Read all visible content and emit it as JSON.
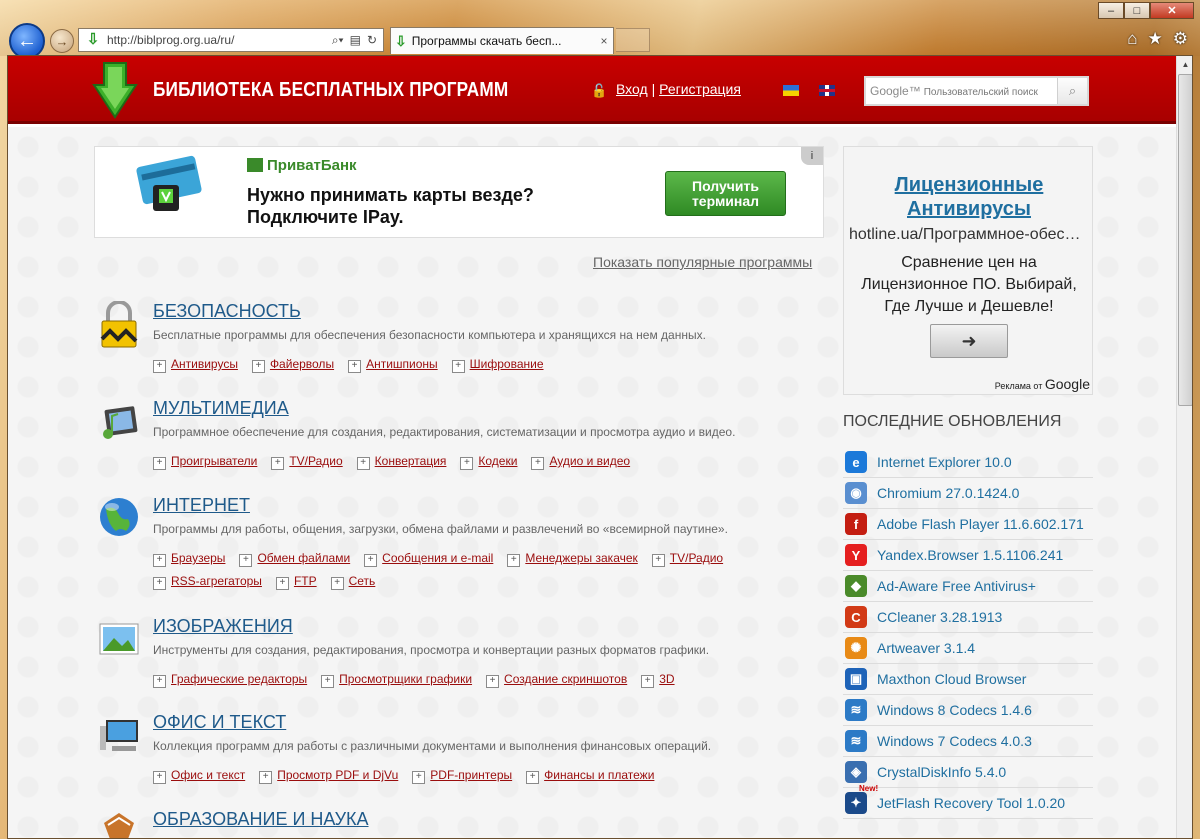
{
  "browser": {
    "url": "http://biblprog.org.ua/ru/",
    "tab_title": "Программы скачать бесп...",
    "tab_close": "×",
    "window_controls": {
      "minimize": "–",
      "maximize": "□",
      "close": "✕"
    }
  },
  "header": {
    "logo_text": "БИБЛИОТЕКА БЕСПЛАТНЫХ ПРОГРАММ",
    "login": "Вход",
    "separator": "|",
    "register": "Регистрация",
    "search_brand": "Google™",
    "search_placeholder": "Пользовательский поиск"
  },
  "banner": {
    "brand": "ПриватБанк",
    "line1": "Нужно принимать карты везде?",
    "line2": "Подключите IPay.",
    "button_line1": "Получить",
    "button_line2": "терминал",
    "info": "i"
  },
  "popular_link": "Показать популярные программы",
  "categories": [
    {
      "title": "БЕЗОПАСНОСТЬ",
      "desc": "Бесплатные программы для обеспечения безопасности компьютера и хранящихся на нем данных.",
      "links": [
        "Антивирусы",
        "Файерволы",
        "Антишпионы",
        "Шифрование"
      ]
    },
    {
      "title": "МУЛЬТИМЕДИА",
      "desc": "Программное обеспечение для создания, редактирования, систематизации и просмотра аудио и видео.",
      "links": [
        "Проигрыватели",
        "TV/Радио",
        "Конвертация",
        "Кодеки",
        "Аудио и видео"
      ]
    },
    {
      "title": "ИНТЕРНЕТ",
      "desc": "Программы для работы, общения, загрузки, обмена файлами и развлечений во «всемирной паутине».",
      "links": [
        "Браузеры",
        "Обмен файлами",
        "Сообщения и e-mail",
        "Менеджеры закачек",
        "TV/Радио",
        "RSS-агрегаторы",
        "FTP",
        "Сеть"
      ]
    },
    {
      "title": "ИЗОБРАЖЕНИЯ",
      "desc": "Инструменты для создания, редактирования, просмотра и конвертации разных форматов графики.",
      "links": [
        "Графические редакторы",
        "Просмотрщики графики",
        "Создание скриншотов",
        "3D"
      ]
    },
    {
      "title": "ОФИС И ТЕКСТ",
      "desc": "Коллекция программ для работы с различными документами и выполнения финансовых операций.",
      "links": [
        "Офис и текст",
        "Просмотр PDF и DjVu",
        "PDF-принтеры",
        "Финансы и платежи"
      ]
    },
    {
      "title": "ОБРАЗОВАНИЕ И НАУКА",
      "desc": "",
      "links": []
    }
  ],
  "sidebar_ad": {
    "title_line1": "Лицензионные",
    "title_line2": "Антивирусы",
    "url": "hotline.ua/Программное-обес…",
    "desc_line1": "Сравнение цен на",
    "desc_line2": "Лицензионное ПО. Выбирай,",
    "desc_line3": "Где Лучше и Дешевле!",
    "button": "➜",
    "ads_by": "Реклама от",
    "ads_brand": "Google"
  },
  "updates": {
    "heading": "ПОСЛЕДНИЕ ОБНОВЛЕНИЯ",
    "new_badge": "New!",
    "items": [
      {
        "name": "Internet Explorer 10.0",
        "icon": "ie-icon",
        "glyph": "e",
        "color": "#1c79d9"
      },
      {
        "name": "Chromium 27.0.1424.0",
        "icon": "chromium-icon",
        "glyph": "◉",
        "color": "#5a8fd0"
      },
      {
        "name": "Adobe Flash Player 11.6.602.171",
        "icon": "flash-icon",
        "glyph": "f",
        "color": "#c41e12"
      },
      {
        "name": "Yandex.Browser 1.5.1106.241",
        "icon": "yandex-icon",
        "glyph": "Y",
        "color": "#e51f1f"
      },
      {
        "name": "Ad-Aware Free Antivirus+",
        "icon": "adaware-icon",
        "glyph": "◆",
        "color": "#4a8a2a"
      },
      {
        "name": "CCleaner 3.28.1913",
        "icon": "ccleaner-icon",
        "glyph": "C",
        "color": "#d23a16"
      },
      {
        "name": "Artweaver 3.1.4",
        "icon": "artweaver-icon",
        "glyph": "✺",
        "color": "#e88a16"
      },
      {
        "name": "Maxthon Cloud Browser",
        "icon": "maxthon-icon",
        "glyph": "▣",
        "color": "#1e63b8"
      },
      {
        "name": "Windows 8 Codecs 1.4.6",
        "icon": "codecs8-icon",
        "glyph": "≋",
        "color": "#2c7ac6"
      },
      {
        "name": "Windows 7 Codecs 4.0.3",
        "icon": "codecs7-icon",
        "glyph": "≋",
        "color": "#2c7ac6"
      },
      {
        "name": "CrystalDiskInfo 5.4.0",
        "icon": "crystaldisk-icon",
        "glyph": "◈",
        "color": "#3a6fb0"
      },
      {
        "name": "JetFlash Recovery Tool 1.0.20",
        "icon": "jetflash-icon",
        "glyph": "✦",
        "color": "#1b4a8a"
      }
    ]
  }
}
